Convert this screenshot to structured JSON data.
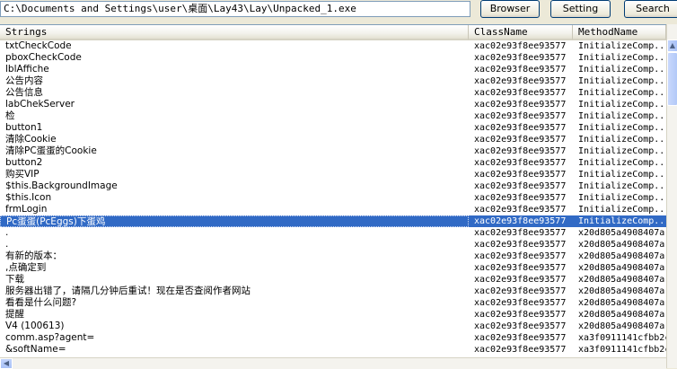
{
  "toolbar": {
    "path_value": "C:\\Documents and Settings\\user\\桌面\\Lay43\\Lay\\Unpacked_1.exe",
    "browser_label": "Browser",
    "setting_label": "Setting",
    "search_label": "Search"
  },
  "table": {
    "columns": [
      "Strings",
      "ClassName",
      "MethodName"
    ],
    "selected_index": 15,
    "rows": [
      [
        "txtCheckCode",
        "xac02e93f8ee93577",
        "InitializeComp..."
      ],
      [
        "pboxCheckCode",
        "xac02e93f8ee93577",
        "InitializeComp..."
      ],
      [
        "lblAffiche",
        "xac02e93f8ee93577",
        "InitializeComp..."
      ],
      [
        "公告内容",
        "xac02e93f8ee93577",
        "InitializeComp..."
      ],
      [
        "公告信息",
        "xac02e93f8ee93577",
        "InitializeComp..."
      ],
      [
        "labChekServer",
        "xac02e93f8ee93577",
        "InitializeComp..."
      ],
      [
        "检",
        "xac02e93f8ee93577",
        "InitializeComp..."
      ],
      [
        "button1",
        "xac02e93f8ee93577",
        "InitializeComp..."
      ],
      [
        "清除Cookie",
        "xac02e93f8ee93577",
        "InitializeComp..."
      ],
      [
        "清除PC蛋蛋的Cookie",
        "xac02e93f8ee93577",
        "InitializeComp..."
      ],
      [
        "button2",
        "xac02e93f8ee93577",
        "InitializeComp..."
      ],
      [
        "购买VIP",
        "xac02e93f8ee93577",
        "InitializeComp..."
      ],
      [
        "$this.BackgroundImage",
        "xac02e93f8ee93577",
        "InitializeComp..."
      ],
      [
        "$this.Icon",
        "xac02e93f8ee93577",
        "InitializeComp..."
      ],
      [
        "frmLogin",
        "xac02e93f8ee93577",
        "InitializeComp..."
      ],
      [
        "Pc蛋蛋(PcEggs)下蛋鸡",
        "xac02e93f8ee93577",
        "InitializeComp..."
      ],
      [
        ".",
        "xac02e93f8ee93577",
        "x20d805a4908407a"
      ],
      [
        ".",
        "xac02e93f8ee93577",
        "x20d805a4908407a"
      ],
      [
        "有新的版本：",
        "xac02e93f8ee93577",
        "x20d805a4908407a"
      ],
      [
        ",点确定到",
        "xac02e93f8ee93577",
        "x20d805a4908407a"
      ],
      [
        "下载",
        "xac02e93f8ee93577",
        "x20d805a4908407a"
      ],
      [
        "服务器出错了，请隔几分钟后重试！现在是否查阅作者网站",
        "xac02e93f8ee93577",
        "x20d805a4908407a"
      ],
      [
        "看看是什么问题?",
        "xac02e93f8ee93577",
        "x20d805a4908407a"
      ],
      [
        "提醒",
        "xac02e93f8ee93577",
        "x20d805a4908407a"
      ],
      [
        " V4 (100613)",
        "xac02e93f8ee93577",
        "x20d805a4908407a"
      ],
      [
        "comm.asp?agent=",
        "xac02e93f8ee93577",
        "xa3f0911141cfbb2c"
      ],
      [
        "&softName=",
        "xac02e93f8ee93577",
        "xa3f0911141cfbb2c"
      ]
    ]
  },
  "colors": {
    "selection": "#316ac5",
    "window_face": "#ece9d8"
  }
}
